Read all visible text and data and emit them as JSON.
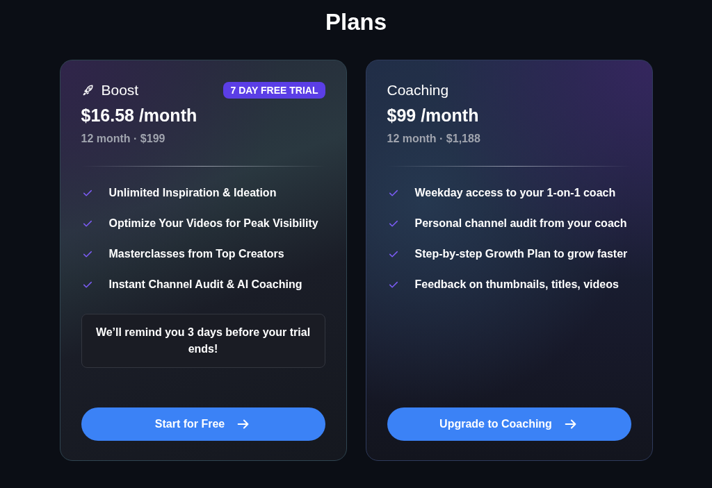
{
  "title": "Plans",
  "plans": [
    {
      "name": "Boost",
      "badge": "7 DAY FREE TRIAL",
      "price": "$16.58 /month",
      "billing": "12 month · $199",
      "features": [
        "Unlimited Inspiration & Ideation",
        "Optimize Your Videos for Peak Visibility",
        "Masterclasses from Top Creators",
        "Instant Channel Audit & AI Coaching"
      ],
      "note": "We’ll remind you 3 days before your trial ends!",
      "button": "Start for Free"
    },
    {
      "name": "Coaching",
      "price": "$99 /month",
      "billing": "12 month · $1,188",
      "features": [
        "Weekday access to your 1-on-1 coach",
        "Personal channel audit from your coach",
        "Step-by-step Growth Plan to grow faster",
        "Feedback on thumbnails, titles, videos"
      ],
      "button": "Upgrade to Coaching"
    }
  ]
}
